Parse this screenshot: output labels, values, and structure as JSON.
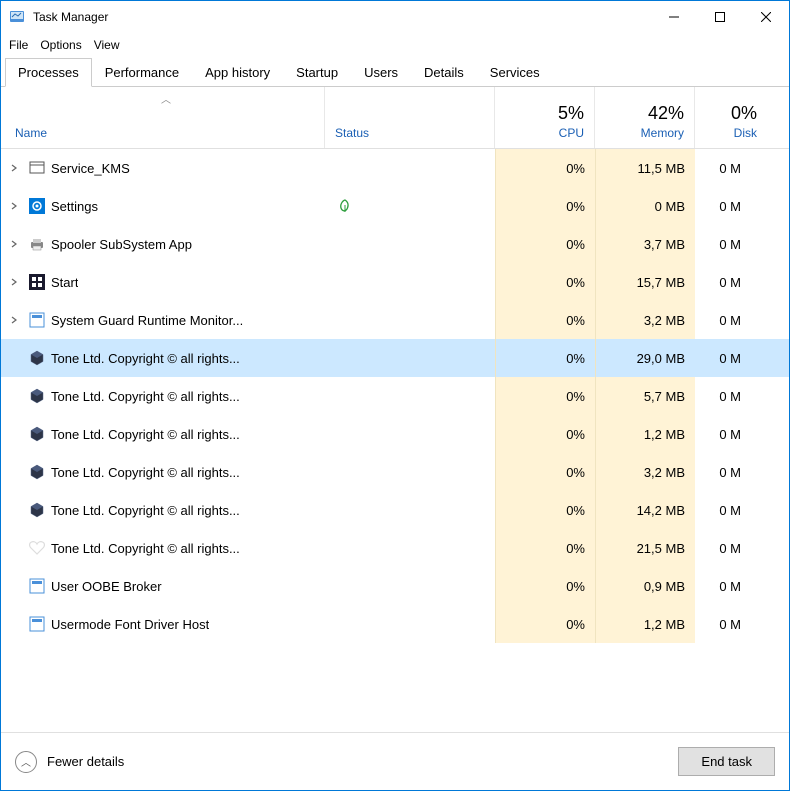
{
  "window": {
    "title": "Task Manager"
  },
  "menu": {
    "file": "File",
    "options": "Options",
    "view": "View"
  },
  "tabs": [
    {
      "label": "Processes",
      "active": true
    },
    {
      "label": "Performance"
    },
    {
      "label": "App history"
    },
    {
      "label": "Startup"
    },
    {
      "label": "Users"
    },
    {
      "label": "Details"
    },
    {
      "label": "Services"
    }
  ],
  "columns": {
    "name": "Name",
    "status": "Status",
    "cpu": {
      "pct": "5%",
      "label": "CPU"
    },
    "memory": {
      "pct": "42%",
      "label": "Memory"
    },
    "disk": {
      "pct": "0%",
      "label": "Disk"
    }
  },
  "rows": [
    {
      "expandable": true,
      "icon": "window",
      "name": "Service_KMS",
      "cpu": "0%",
      "mem": "11,5 MB",
      "disk": "0 M"
    },
    {
      "expandable": true,
      "icon": "gear-blue",
      "name": "Settings",
      "leaf": true,
      "cpu": "0%",
      "mem": "0 MB",
      "disk": "0 M"
    },
    {
      "expandable": true,
      "icon": "printer",
      "name": "Spooler SubSystem App",
      "cpu": "0%",
      "mem": "3,7 MB",
      "disk": "0 M"
    },
    {
      "expandable": true,
      "icon": "start-dark",
      "name": "Start",
      "cpu": "0%",
      "mem": "15,7 MB",
      "disk": "0 M"
    },
    {
      "expandable": true,
      "icon": "app",
      "name": "System Guard Runtime Monitor...",
      "cpu": "0%",
      "mem": "3,2 MB",
      "disk": "0 M"
    },
    {
      "expandable": false,
      "icon": "hex",
      "name": "Tone Ltd. Copyright © all rights...",
      "selected": true,
      "cpu": "0%",
      "mem": "29,0 MB",
      "disk": "0 M"
    },
    {
      "expandable": false,
      "icon": "hex",
      "name": "Tone Ltd. Copyright © all rights...",
      "cpu": "0%",
      "mem": "5,7 MB",
      "disk": "0 M"
    },
    {
      "expandable": false,
      "icon": "hex",
      "name": "Tone Ltd. Copyright © all rights...",
      "cpu": "0%",
      "mem": "1,2 MB",
      "disk": "0 M"
    },
    {
      "expandable": false,
      "icon": "hex",
      "name": "Tone Ltd. Copyright © all rights...",
      "cpu": "0%",
      "mem": "3,2 MB",
      "disk": "0 M"
    },
    {
      "expandable": false,
      "icon": "hex",
      "name": "Tone Ltd. Copyright © all rights...",
      "cpu": "0%",
      "mem": "14,2 MB",
      "disk": "0 M"
    },
    {
      "expandable": false,
      "icon": "heart",
      "name": "Tone Ltd. Copyright © all rights...",
      "cpu": "0%",
      "mem": "21,5 MB",
      "disk": "0 M"
    },
    {
      "expandable": false,
      "icon": "app",
      "name": "User OOBE Broker",
      "cpu": "0%",
      "mem": "0,9 MB",
      "disk": "0 M"
    },
    {
      "expandable": false,
      "icon": "app",
      "name": "Usermode Font Driver Host",
      "cpu": "0%",
      "mem": "1,2 MB",
      "disk": "0 M"
    }
  ],
  "footer": {
    "fewer": "Fewer details",
    "endtask": "End task"
  }
}
